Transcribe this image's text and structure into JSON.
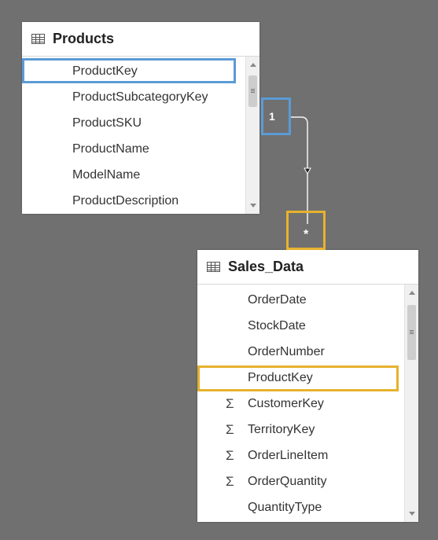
{
  "products": {
    "title": "Products",
    "fields": [
      {
        "name": "ProductKey",
        "measure": false
      },
      {
        "name": "ProductSubcategoryKey",
        "measure": false
      },
      {
        "name": "ProductSKU",
        "measure": false
      },
      {
        "name": "ProductName",
        "measure": false
      },
      {
        "name": "ModelName",
        "measure": false
      },
      {
        "name": "ProductDescription",
        "measure": false
      }
    ],
    "highlighted_field": "ProductKey"
  },
  "sales_data": {
    "title": "Sales_Data",
    "fields": [
      {
        "name": "OrderDate",
        "measure": false
      },
      {
        "name": "StockDate",
        "measure": false
      },
      {
        "name": "OrderNumber",
        "measure": false
      },
      {
        "name": "ProductKey",
        "measure": false
      },
      {
        "name": "CustomerKey",
        "measure": true
      },
      {
        "name": "TerritoryKey",
        "measure": true
      },
      {
        "name": "OrderLineItem",
        "measure": true
      },
      {
        "name": "OrderQuantity",
        "measure": true
      },
      {
        "name": "QuantityType",
        "measure": false
      }
    ],
    "highlighted_field": "ProductKey"
  },
  "relationship": {
    "one_side_label": "1",
    "many_side_label": "*"
  },
  "sigma_symbol": "Σ",
  "colors": {
    "background": "#707070",
    "one_side_highlight": "#5b9bd5",
    "many_side_highlight": "#e6b22e"
  },
  "icons": {
    "table": "table-icon",
    "measure": "sigma-icon"
  }
}
